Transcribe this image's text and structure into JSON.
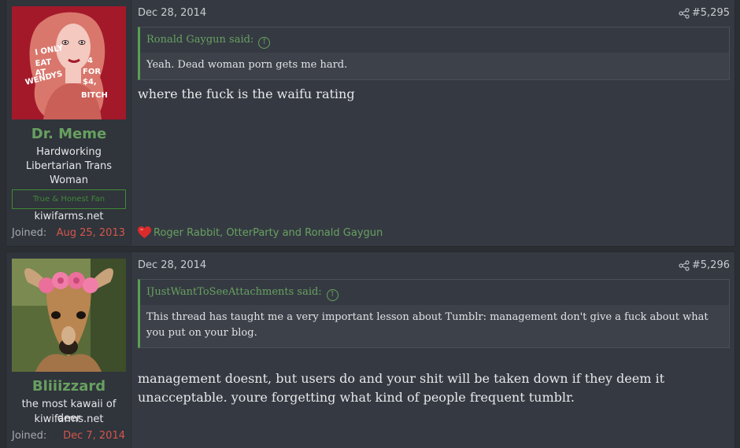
{
  "posts": [
    {
      "username": "Dr. Meme",
      "user_title": "Hardworking Libertarian Trans Woman",
      "banner": "True & Honest Fan",
      "site": "kiwifarms.net",
      "joined_label": "Joined:",
      "joined_date": "Aug 25, 2013",
      "avatar_text": [
        "I ONLY",
        "EAT",
        "AT",
        "WENDYS",
        "4",
        "FOR",
        "$4,",
        "BITCH"
      ],
      "date": "Dec 28, 2014",
      "post_number": "#5,295",
      "quote_author": "Ronald Gaygun said:",
      "quote_text": "Yeah. Dead woman porn gets me hard.",
      "message": "where the fuck is the waifu rating",
      "reactions": "Roger Rabbit, OtterParty and Ronald Gaygun"
    },
    {
      "username": "Bliiizzard",
      "user_title": "the most kawaii of deer",
      "site": "kiwifarms.net",
      "joined_label": "Joined:",
      "joined_date": "Dec 7, 2014",
      "date": "Dec 28, 2014",
      "post_number": "#5,296",
      "quote_author": "IJustWantToSeeAttachments said:",
      "quote_text": "This thread has taught me a very important lesson about Tumblr: management don't give a fuck about what you put on your blog.",
      "message": "management doesnt, but users do and your shit will be taken down if they deem it unacceptable. youre forgetting what kind of people frequent tumblr."
    }
  ],
  "colors": {
    "accent_green": "#67a060",
    "joined_red": "#d5564c",
    "avatar_bg": "#a3192a"
  },
  "icons": {
    "share": "share-icon",
    "quote_arrow": "arrow-up-circle-icon",
    "reaction": "heart-icon"
  }
}
